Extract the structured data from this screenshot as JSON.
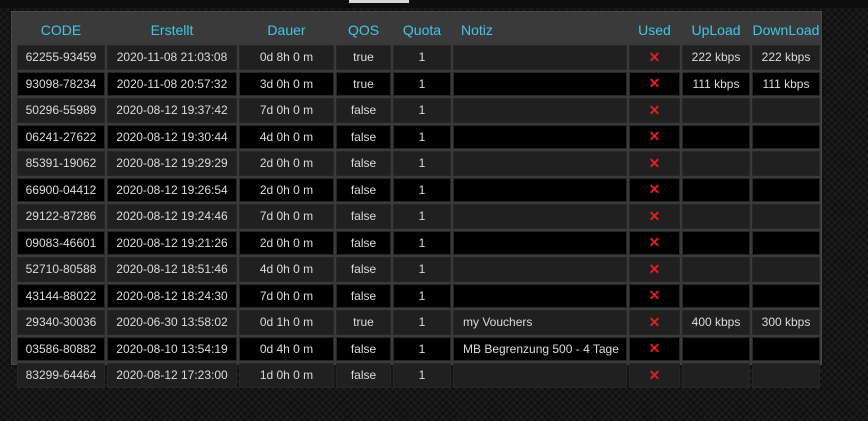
{
  "columns": [
    "CODE",
    "Erstellt",
    "Dauer",
    "QOS",
    "Quota",
    "Notiz",
    "Used",
    "UpLoad",
    "DownLoad"
  ],
  "used_icon": "close-icon",
  "colors": {
    "header": "#3ec8e8",
    "used_mark": "#e02020"
  },
  "rows": [
    {
      "code": "62255-93459",
      "created": "2020-11-08 21:03:08",
      "duration": "0d 8h 0 m",
      "qos": "true",
      "quota": "1",
      "note": "",
      "used": "✕",
      "upload": "222 kbps",
      "download": "222 kbps"
    },
    {
      "code": "93098-78234",
      "created": "2020-11-08 20:57:32",
      "duration": "3d 0h 0 m",
      "qos": "true",
      "quota": "1",
      "note": "",
      "used": "✕",
      "upload": "111 kbps",
      "download": "111 kbps"
    },
    {
      "code": "50296-55989",
      "created": "2020-08-12 19:37:42",
      "duration": "7d 0h 0 m",
      "qos": "false",
      "quota": "1",
      "note": "",
      "used": "✕",
      "upload": "",
      "download": ""
    },
    {
      "code": "06241-27622",
      "created": "2020-08-12 19:30:44",
      "duration": "4d 0h 0 m",
      "qos": "false",
      "quota": "1",
      "note": "",
      "used": "✕",
      "upload": "",
      "download": ""
    },
    {
      "code": "85391-19062",
      "created": "2020-08-12 19:29:29",
      "duration": "2d 0h 0 m",
      "qos": "false",
      "quota": "1",
      "note": "",
      "used": "✕",
      "upload": "",
      "download": ""
    },
    {
      "code": "66900-04412",
      "created": "2020-08-12 19:26:54",
      "duration": "2d 0h 0 m",
      "qos": "false",
      "quota": "1",
      "note": "",
      "used": "✕",
      "upload": "",
      "download": ""
    },
    {
      "code": "29122-87286",
      "created": "2020-08-12 19:24:46",
      "duration": "7d 0h 0 m",
      "qos": "false",
      "quota": "1",
      "note": "",
      "used": "✕",
      "upload": "",
      "download": ""
    },
    {
      "code": "09083-46601",
      "created": "2020-08-12 19:21:26",
      "duration": "2d 0h 0 m",
      "qos": "false",
      "quota": "1",
      "note": "",
      "used": "✕",
      "upload": "",
      "download": ""
    },
    {
      "code": "52710-80588",
      "created": "2020-08-12 18:51:46",
      "duration": "4d 0h 0 m",
      "qos": "false",
      "quota": "1",
      "note": "",
      "used": "✕",
      "upload": "",
      "download": ""
    },
    {
      "code": "43144-88022",
      "created": "2020-08-12 18:24:30",
      "duration": "7d 0h 0 m",
      "qos": "false",
      "quota": "1",
      "note": "",
      "used": "✕",
      "upload": "",
      "download": ""
    },
    {
      "code": "29340-30036",
      "created": "2020-06-30 13:58:02",
      "duration": "0d 1h 0 m",
      "qos": "true",
      "quota": "1",
      "note": "my Vouchers",
      "used": "✕",
      "upload": "400 kbps",
      "download": "300 kbps"
    },
    {
      "code": "03586-80882",
      "created": "2020-08-10 13:54:19",
      "duration": "0d 4h 0 m",
      "qos": "false",
      "quota": "1",
      "note": "MB Begrenzung 500 - 4 Tage",
      "used": "✕",
      "upload": "",
      "download": ""
    },
    {
      "code": "83299-64464",
      "created": "2020-08-12 17:23:00",
      "duration": "1d 0h 0 m",
      "qos": "false",
      "quota": "1",
      "note": "",
      "used": "✕",
      "upload": "",
      "download": ""
    }
  ]
}
